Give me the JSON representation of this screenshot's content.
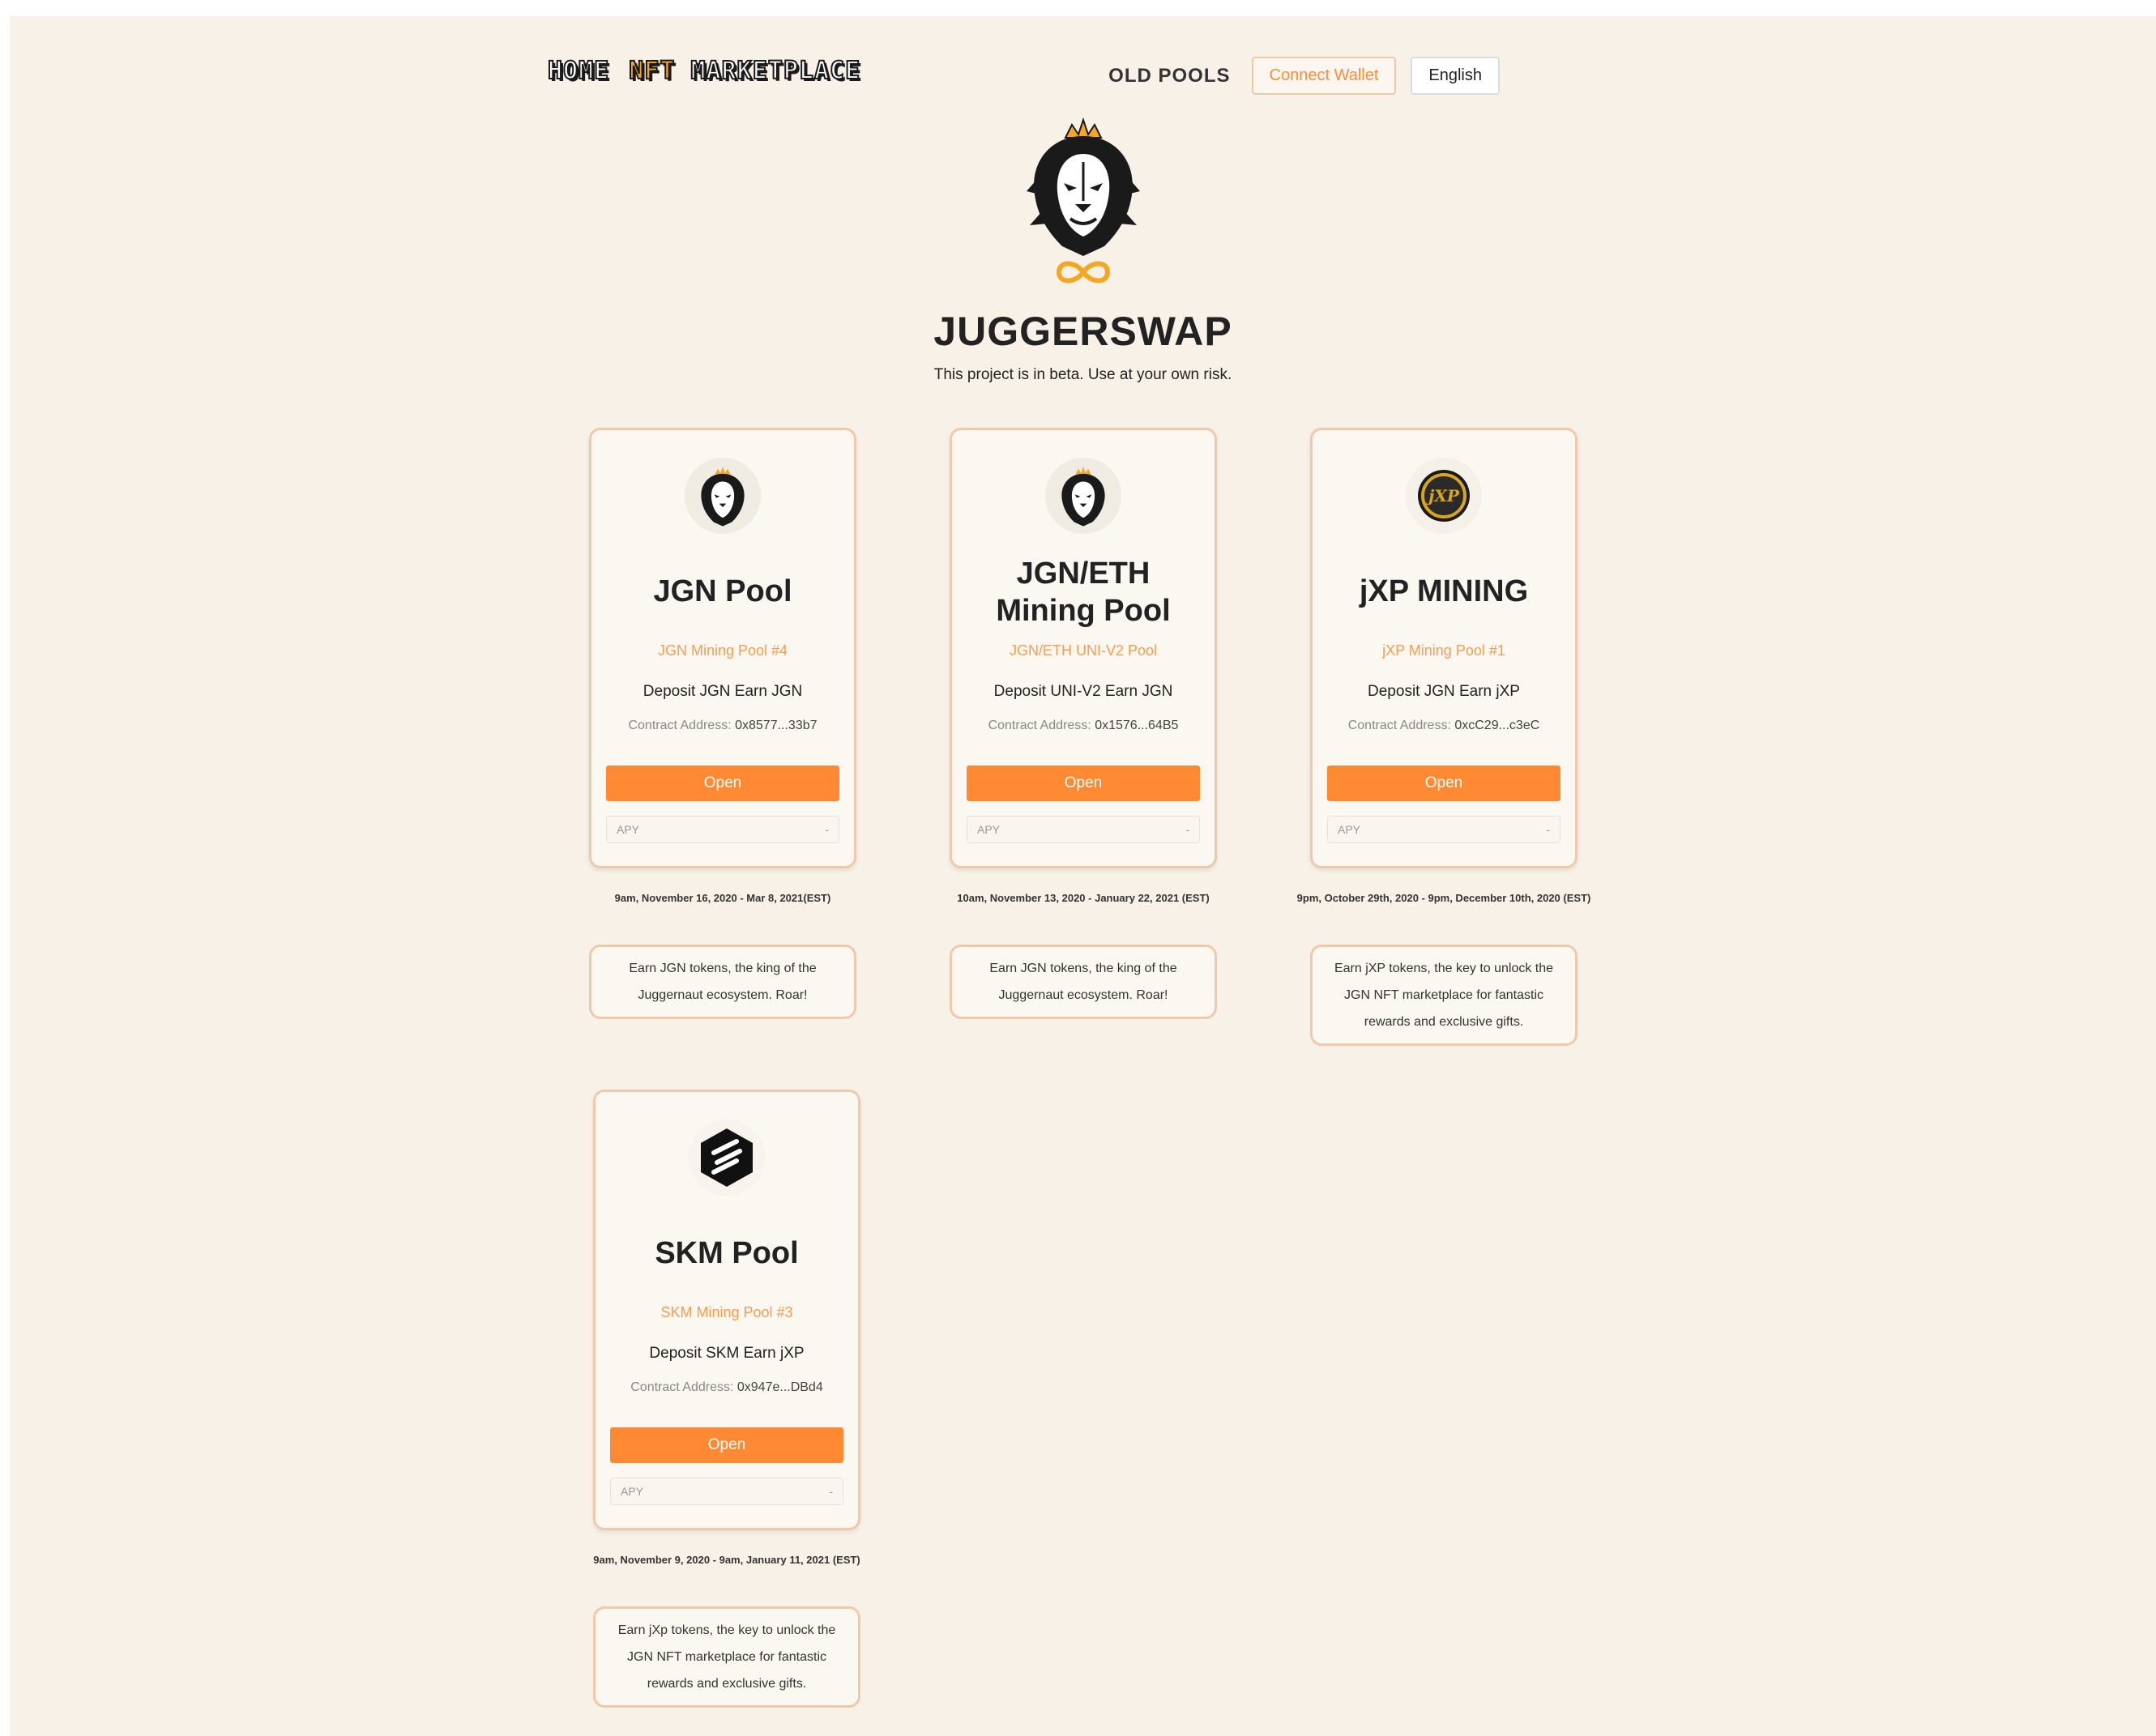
{
  "nav": {
    "home": "HOME",
    "nft": "NFT",
    "marketplace": "MARKETPLACE",
    "old_pools": "OLD POOLS",
    "connect_wallet": "Connect Wallet",
    "language": "English"
  },
  "hero": {
    "title": "JUGGERSWAP",
    "subtitle": "This project is in beta. Use at your own risk."
  },
  "pools": [
    {
      "title": "JGN Pool",
      "subtitle": "JGN Mining Pool #4",
      "desc": "Deposit JGN Earn JGN",
      "addr_label": "Contract Address:",
      "addr": "0x8577...33b7",
      "open": "Open",
      "apy_label": "APY",
      "apy_value": "-",
      "dates": "9am, November 16, 2020 - Mar 8, 2021(EST)",
      "info": "Earn JGN tokens, the king of the Juggernaut ecosystem. Roar!"
    },
    {
      "title": "JGN/ETH Mining Pool",
      "subtitle": "JGN/ETH UNI-V2 Pool",
      "desc": "Deposit UNI-V2 Earn JGN",
      "addr_label": "Contract Address:",
      "addr": "0x1576...64B5",
      "open": "Open",
      "apy_label": "APY",
      "apy_value": "-",
      "dates": "10am, November 13, 2020 - January 22, 2021 (EST)",
      "info": "Earn JGN tokens, the king of the Juggernaut ecosystem. Roar!"
    },
    {
      "title": "jXP MINING",
      "subtitle": "jXP Mining Pool #1",
      "desc": "Deposit JGN Earn jXP",
      "addr_label": "Contract Address:",
      "addr": "0xcC29...c3eC",
      "open": "Open",
      "apy_label": "APY",
      "apy_value": "-",
      "dates": "9pm, October 29th, 2020 - 9pm, December 10th, 2020 (EST)",
      "info": "Earn jXP tokens, the key to unlock the JGN NFT marketplace for fantastic rewards and exclusive gifts."
    },
    {
      "title": "SKM Pool",
      "subtitle": "SKM Mining Pool #3",
      "desc": "Deposit SKM Earn jXP",
      "addr_label": "Contract Address:",
      "addr": "0x947e...DBd4",
      "open": "Open",
      "apy_label": "APY",
      "apy_value": "-",
      "dates": "9am, November 9, 2020 - 9am, January 11, 2021 (EST)",
      "info": "Earn jXp tokens, the key to unlock the JGN NFT marketplace for fantastic rewards and exclusive gifts."
    }
  ],
  "icons": {
    "jxp_logo_text": "jXP"
  },
  "colors": {
    "background": "#f8f1e7",
    "accent": "#ff8a33",
    "card_border": "#f0c9ab"
  }
}
